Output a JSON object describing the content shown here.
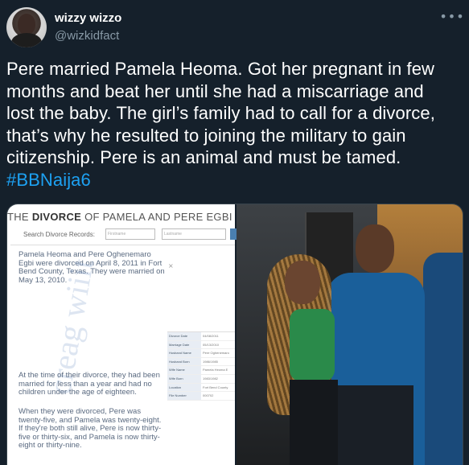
{
  "tweet": {
    "author_name": "wizzy wizzo",
    "author_handle": "@wizkidfact",
    "more_icon": "more-horizontal-icon",
    "text_lines": [
      "Pere married Pamela Heoma. Got her pregnant in few",
      "months and beat her until she had a miscarriage and",
      "lost the baby. The girl’s family had to call for a divorce,",
      "that’s why he resulted to joining the military to gain",
      "citizenship. Pere is an animal and must be tamed."
    ],
    "hashtag": "#BBNaija6"
  },
  "document": {
    "title_prefix": "THE ",
    "title_bold": "DIVORCE",
    "title_suffix": " OF PAMELA AND PERE EGBI",
    "search_label": "Search Divorce Records:",
    "first_name_placeholder": "Firstname",
    "last_name_placeholder": "Lastname",
    "close_mark": "×",
    "para1": "Pamela Heoma and Pere Oghenemaro Egbi were divorced on April 8, 2011 in Fort Bend County, Texas. They were married on May 13, 2010.",
    "para2": "At the time of their divorce, they had been married for less than a year and had no children under the age of eighteen.",
    "para3": "When they were divorced, Pere was twenty-five, and Pamela was twenty-eight. If they're both still alive, Pere is now thirty-five or thirty-six, and Pamela is now thirty-eight or thirty-nine.",
    "watermark": "creag wiiit",
    "records": [
      {
        "key": "Divorce Date",
        "value": "04/08/2011"
      },
      {
        "key": "Marriage Date",
        "value": "05/13/2010"
      },
      {
        "key": "Husband Name",
        "value": "Pere Oghenemaro"
      },
      {
        "key": "Husband Born",
        "value": "1986/1985"
      },
      {
        "key": "Wife Name",
        "value": "Pamela Heoma E"
      },
      {
        "key": "Wife Born",
        "value": "1983/1982"
      },
      {
        "key": "Location",
        "value": "Fort Bend County"
      },
      {
        "key": "File Number",
        "value": "000702"
      }
    ]
  },
  "colors": {
    "background": "#15202b",
    "secondary_text": "#8899a6",
    "hashtag": "#1da1f2"
  }
}
